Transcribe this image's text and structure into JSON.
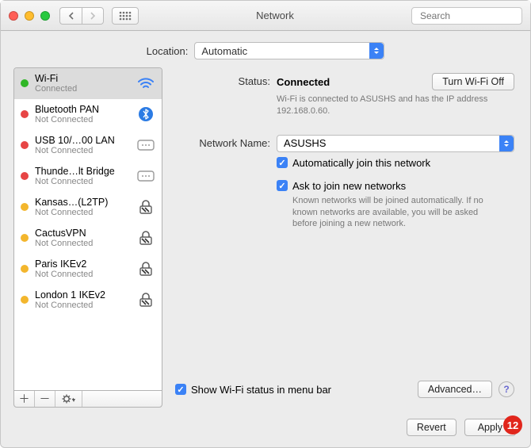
{
  "window": {
    "title": "Network"
  },
  "search": {
    "placeholder": "Search"
  },
  "location": {
    "label": "Location:",
    "value": "Automatic"
  },
  "sidebar": {
    "items": [
      {
        "name": "Wi-Fi",
        "sub": "Connected",
        "status": "green",
        "icon": "wifi"
      },
      {
        "name": "Bluetooth PAN",
        "sub": "Not Connected",
        "status": "red",
        "icon": "bluetooth"
      },
      {
        "name": "USB 10/…00 LAN",
        "sub": "Not Connected",
        "status": "red",
        "icon": "ethernet"
      },
      {
        "name": "Thunde…lt Bridge",
        "sub": "Not Connected",
        "status": "red",
        "icon": "ethernet"
      },
      {
        "name": "Kansas…(L2TP)",
        "sub": "Not Connected",
        "status": "yellow",
        "icon": "vpn"
      },
      {
        "name": "CactusVPN",
        "sub": "Not Connected",
        "status": "yellow",
        "icon": "vpn"
      },
      {
        "name": "Paris IKEv2",
        "sub": "Not Connected",
        "status": "yellow",
        "icon": "vpn"
      },
      {
        "name": "London 1 IKEv2",
        "sub": "Not Connected",
        "status": "yellow",
        "icon": "vpn"
      }
    ]
  },
  "main": {
    "status_label": "Status:",
    "status_value": "Connected",
    "turn_off": "Turn Wi-Fi Off",
    "status_desc": "Wi-Fi is connected to ASUSHS and has the IP address 192.168.0.60.",
    "network_name_label": "Network Name:",
    "network_name_value": "ASUSHS",
    "auto_join": "Automatically join this network",
    "ask_join": "Ask to join new networks",
    "ask_join_desc": "Known networks will be joined automatically. If no known networks are available, you will be asked before joining a new network.",
    "show_menubar": "Show Wi-Fi status in menu bar",
    "advanced": "Advanced…"
  },
  "footer": {
    "revert": "Revert",
    "apply": "Apply",
    "badge": "12"
  }
}
